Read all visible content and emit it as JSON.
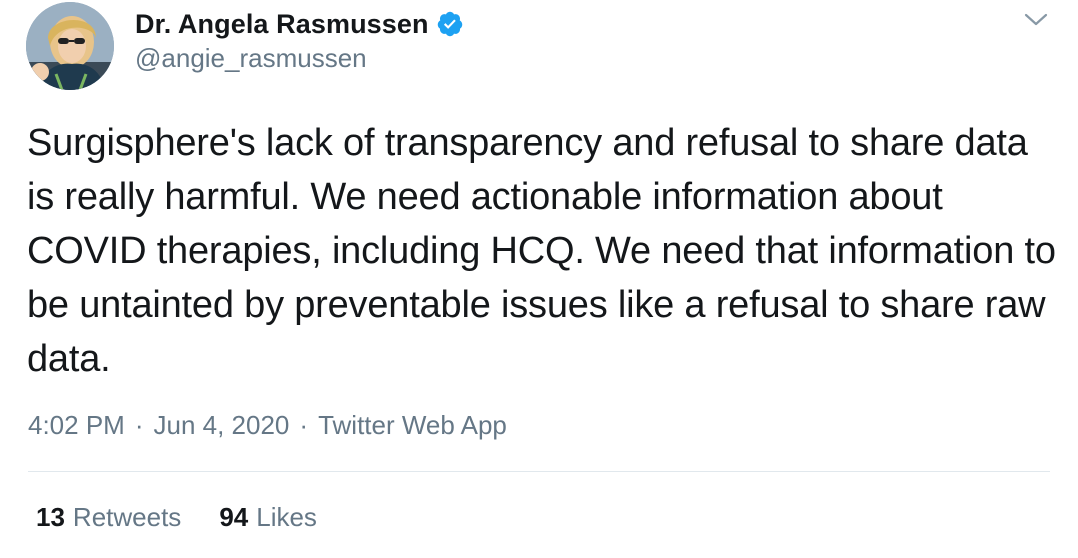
{
  "author": {
    "display_name": "Dr. Angela Rasmussen",
    "handle": "@angie_rasmussen",
    "verified": true,
    "verified_icon": "verified-badge-icon",
    "verified_color": "#1da1f2"
  },
  "tweet": {
    "text": "Surgisphere's lack of transparency and refusal to share data is really harmful. We need actionable information about COVID therapies, including HCQ. We need that information to be untainted by preventable issues like a refusal to share raw data.",
    "time": "4:02 PM",
    "date": "Jun 4, 2020",
    "source": "Twitter Web App",
    "separator": "·"
  },
  "stats": {
    "retweets_count": "13",
    "retweets_label": "Retweets",
    "likes_count": "94",
    "likes_label": "Likes"
  },
  "colors": {
    "text_primary": "#14171a",
    "text_secondary": "#657786",
    "divider": "#e1e8ed",
    "accent": "#1da1f2"
  },
  "icons": {
    "menu": "chevron-down-icon",
    "avatar": "profile-photo"
  }
}
